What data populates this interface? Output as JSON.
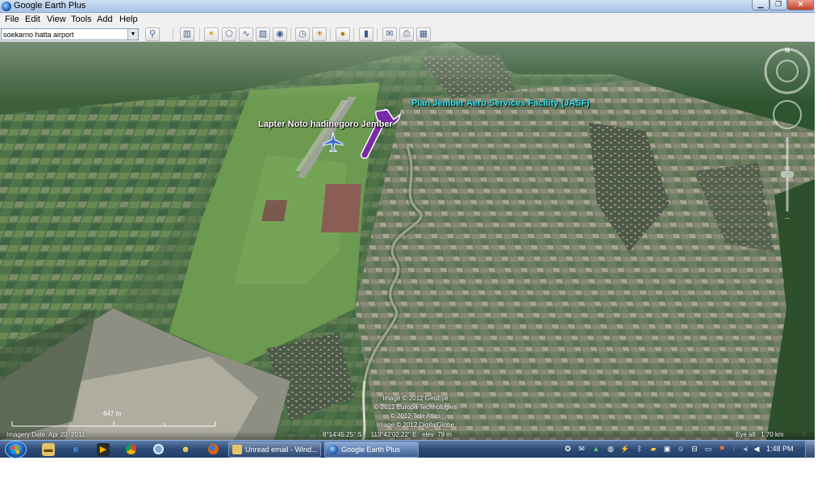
{
  "window": {
    "title": "Google Earth Plus"
  },
  "menu": [
    "File",
    "Edit",
    "View",
    "Tools",
    "Add",
    "Help"
  ],
  "search": {
    "value": "soekarno hatta airport"
  },
  "map": {
    "placemark_airport": "Lapter Noto hadinegoro Jember",
    "placemark_jasf": "Plan Jember Aero Services Facility (JASF)",
    "scale_label": "647 m",
    "credits": [
      "Image © 2012 GeoEye",
      "© 2012 Europa Technologies",
      "© 2012 Tele Atlas",
      "Image © 2012 DigitalGlobe"
    ],
    "compass_letter": "N"
  },
  "status": {
    "imagery_date": "Imagery Date: Apr 20, 2011",
    "coordinates": "8°14'45.25\" S     113°42'02.22\" E   elev  79 m",
    "eye_alt": "Eye alt   1.70 km"
  },
  "taskbar": {
    "windows": [
      "Unread email - Wind...",
      "Google Earth Plus"
    ],
    "clock": "1:48 PM"
  }
}
